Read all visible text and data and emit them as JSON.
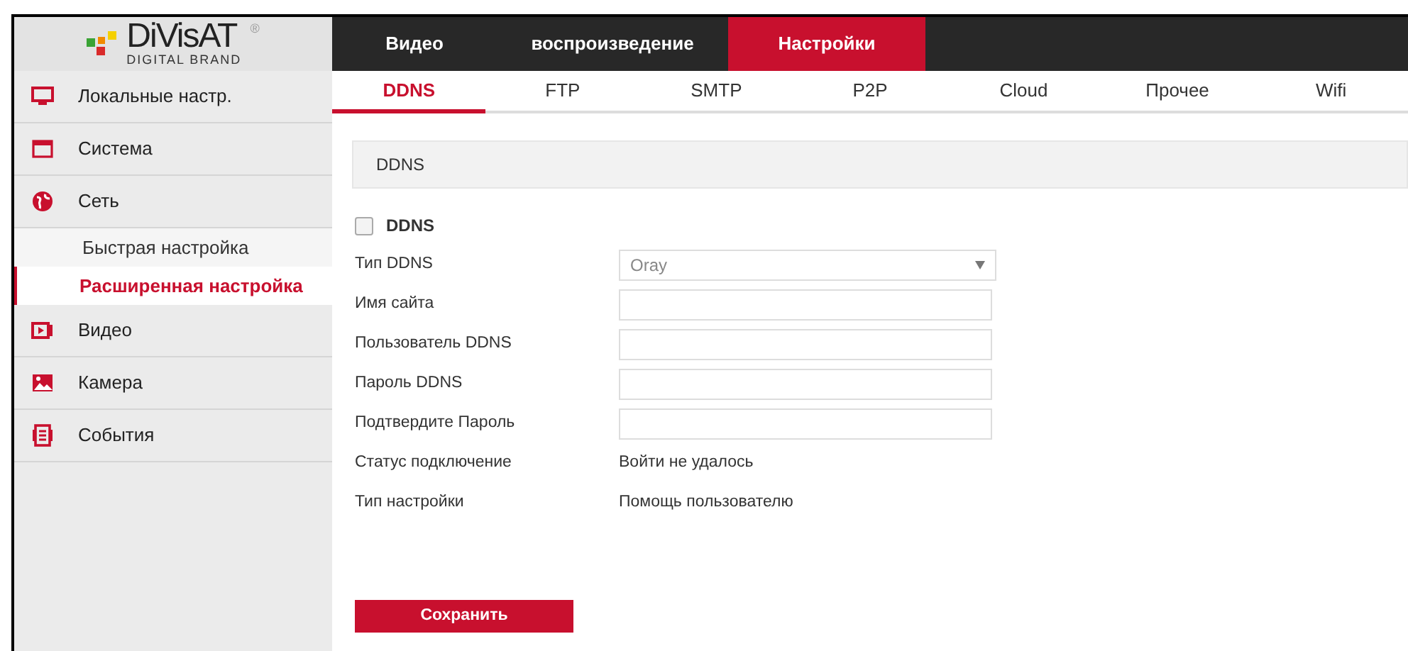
{
  "logo": {
    "name": "DiVisAT",
    "mark": "®",
    "tagline": "DIGITAL BRAND"
  },
  "top_tabs": [
    {
      "label": "Видео",
      "selected": false
    },
    {
      "label": "воспроизведение",
      "selected": false
    },
    {
      "label": "Настройки",
      "selected": true
    }
  ],
  "sidebar": {
    "items": [
      {
        "label": "Локальные настр."
      },
      {
        "label": "Система"
      },
      {
        "label": "Сеть",
        "children": [
          {
            "label": "Быстрая настройка",
            "selected": false
          },
          {
            "label": "Расширенная настройка",
            "selected": true
          }
        ]
      },
      {
        "label": "Видео"
      },
      {
        "label": "Камера"
      },
      {
        "label": "События"
      }
    ]
  },
  "sub_tabs": [
    {
      "label": "DDNS",
      "selected": true
    },
    {
      "label": "FTP",
      "selected": false
    },
    {
      "label": "SMTP",
      "selected": false
    },
    {
      "label": "P2P",
      "selected": false
    },
    {
      "label": "Cloud",
      "selected": false
    },
    {
      "label": "Прочее",
      "selected": false
    },
    {
      "label": "Wifi",
      "selected": false
    }
  ],
  "section_title": "DDNS",
  "enable": {
    "label": "DDNS",
    "checked": false
  },
  "fields": [
    {
      "kind": "select",
      "label": "Тип DDNS",
      "value": "Oray"
    },
    {
      "kind": "input",
      "label": "Имя сайта"
    },
    {
      "kind": "input",
      "label": "Пользователь DDNS"
    },
    {
      "kind": "input",
      "label": "Пароль DDNS"
    },
    {
      "kind": "input",
      "label": "Подтвердите Пароль"
    },
    {
      "kind": "text",
      "label": "Статус подключение",
      "value": "Войти не удалось"
    },
    {
      "kind": "text",
      "label": "Тип настройки",
      "value": "Помощь пользователю"
    }
  ],
  "save_button": "Сохранить"
}
